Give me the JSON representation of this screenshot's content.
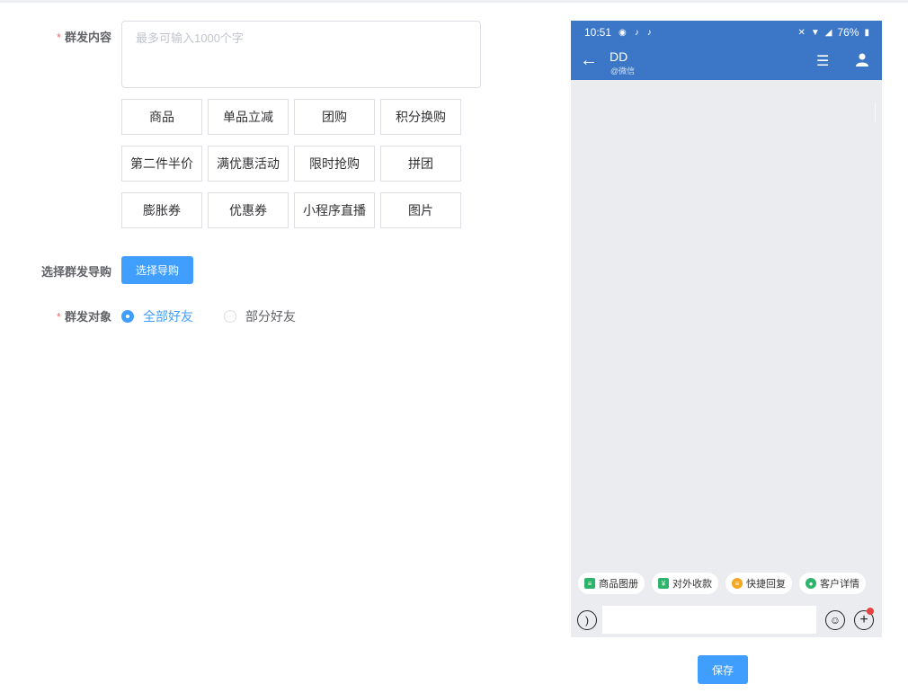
{
  "form": {
    "content_label": "群发内容",
    "content_placeholder": "最多可输入1000个字",
    "content_value": "",
    "required_mark": "*",
    "tools": [
      "商品",
      "单品立减",
      "团购",
      "积分换购",
      "第二件半价",
      "满优惠活动",
      "限时抢购",
      "拼团",
      "膨胀券",
      "优惠券",
      "小程序直播",
      "图片"
    ],
    "guide_label": "选择群发导购",
    "guide_button": "选择导购",
    "target_label": "群发对象",
    "target_options": [
      "全部好友",
      "部分好友"
    ],
    "target_selected": "全部好友"
  },
  "phone": {
    "status": {
      "time": "10:51",
      "battery": "76%"
    },
    "chat_name": "DD",
    "chat_sub": "@微信",
    "quick_actions": [
      {
        "label": "商品图册",
        "color": "#2db36a"
      },
      {
        "label": "对外收款",
        "color": "#2db36a"
      },
      {
        "label": "快捷回复",
        "color": "#f5a623"
      },
      {
        "label": "客户详情",
        "color": "#2db36a"
      }
    ]
  },
  "save_button": "保存"
}
